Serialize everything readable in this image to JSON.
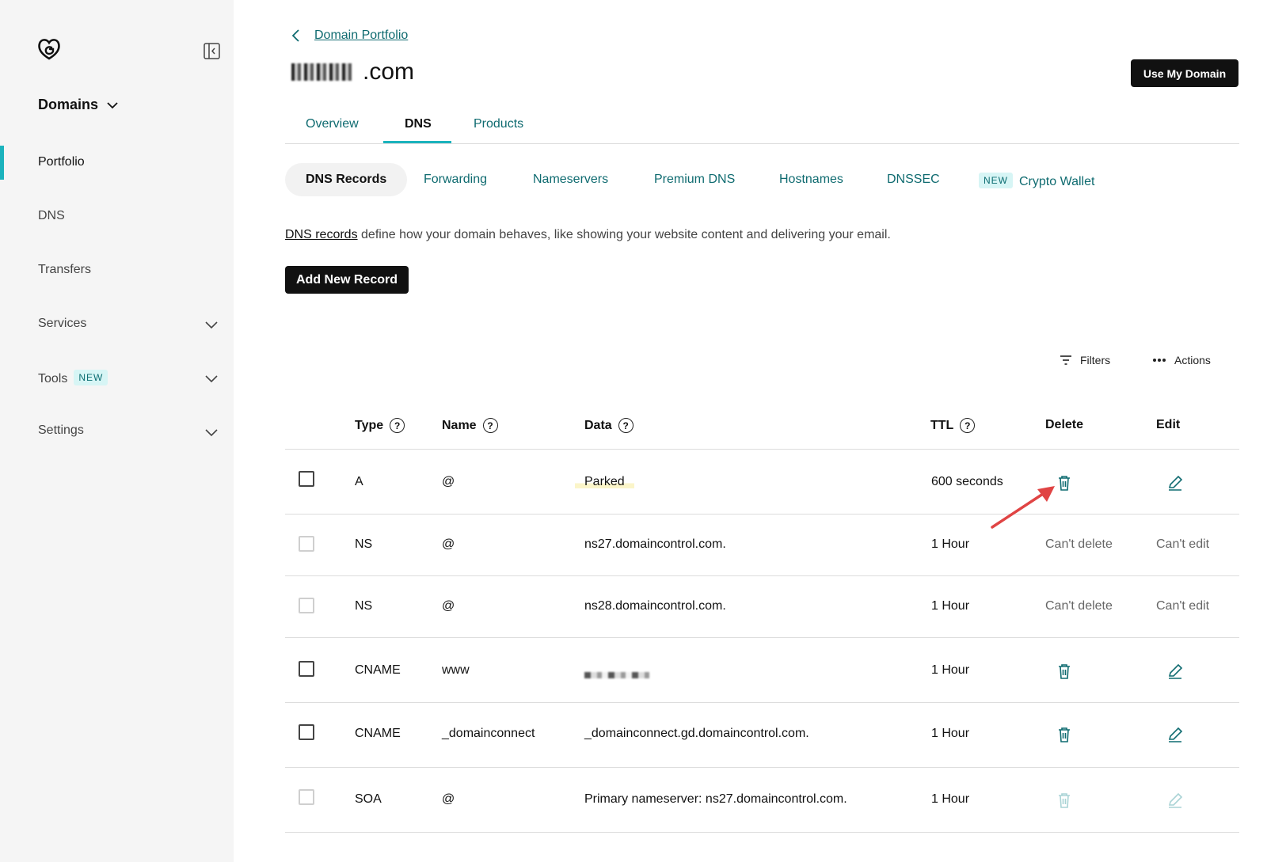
{
  "sidebar": {
    "domains_label": "Domains",
    "items": [
      {
        "label": "Portfolio"
      },
      {
        "label": "DNS"
      },
      {
        "label": "Transfers"
      },
      {
        "label": "Services"
      },
      {
        "label": "Tools",
        "badge": "NEW"
      },
      {
        "label": "Settings"
      }
    ]
  },
  "header": {
    "back_link": "Domain Portfolio",
    "domain_suffix": ".com",
    "use_domain_button": "Use My Domain"
  },
  "tabs": [
    {
      "label": "Overview"
    },
    {
      "label": "DNS"
    },
    {
      "label": "Products"
    }
  ],
  "subtabs": [
    {
      "label": "DNS Records"
    },
    {
      "label": "Forwarding"
    },
    {
      "label": "Nameservers"
    },
    {
      "label": "Premium DNS"
    },
    {
      "label": "Hostnames"
    },
    {
      "label": "DNSSEC"
    },
    {
      "label": "Crypto Wallet",
      "badge": "NEW"
    }
  ],
  "intro": {
    "link": "DNS records",
    "text": " define how your domain behaves, like showing your website content and delivering your email."
  },
  "add_button": "Add New Record",
  "toolbar": {
    "filters": "Filters",
    "actions": "Actions"
  },
  "columns": {
    "type": "Type",
    "name": "Name",
    "data": "Data",
    "ttl": "TTL",
    "delete": "Delete",
    "edit": "Edit"
  },
  "records": [
    {
      "type": "A",
      "name": "@",
      "data": "Parked",
      "ttl": "600 seconds"
    },
    {
      "type": "NS",
      "name": "@",
      "data": "ns27.domaincontrol.com.",
      "ttl": "1 Hour",
      "delete": "Can't delete",
      "edit": "Can't edit"
    },
    {
      "type": "NS",
      "name": "@",
      "data": "ns28.domaincontrol.com.",
      "ttl": "1 Hour",
      "delete": "Can't delete",
      "edit": "Can't edit"
    },
    {
      "type": "CNAME",
      "name": "www",
      "data": "",
      "ttl": "1 Hour"
    },
    {
      "type": "CNAME",
      "name": "_domainconnect",
      "data": "_domainconnect.gd.domaincontrol.com.",
      "ttl": "1 Hour"
    },
    {
      "type": "SOA",
      "name": "@",
      "data": "Primary nameserver: ns27.domaincontrol.com.",
      "ttl": "1 Hour"
    }
  ],
  "colors": {
    "accent": "#1bb3bd",
    "link": "#0f6b70",
    "annotation_arrow": "#e04444"
  }
}
